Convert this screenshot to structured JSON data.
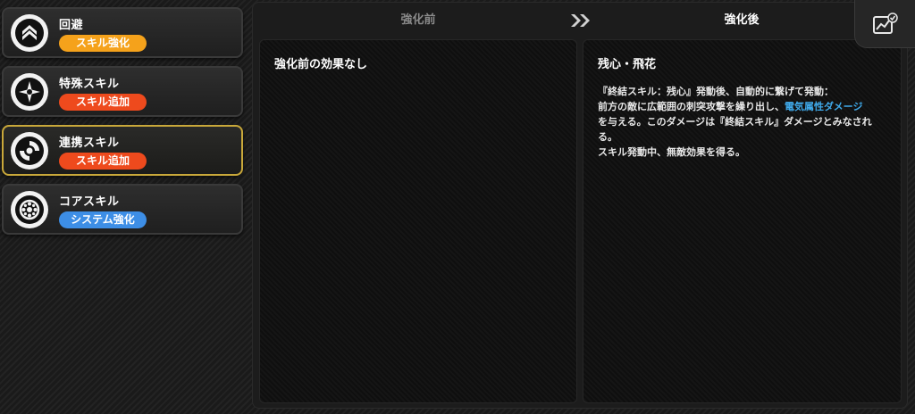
{
  "skills": [
    {
      "name": "回避",
      "tag": "スキル強化",
      "tag_color": "#f5a21b",
      "icon": "evasion-chevron-icon",
      "selected": false
    },
    {
      "name": "特殊スキル",
      "tag": "スキル追加",
      "tag_color": "#ee4a1d",
      "icon": "special-star-icon",
      "selected": false
    },
    {
      "name": "連携スキル",
      "tag": "スキル追加",
      "tag_color": "#ee4a1d",
      "icon": "chain-swirl-icon",
      "selected": true
    },
    {
      "name": "コアスキル",
      "tag": "システム強化",
      "tag_color": "#3d8ee6",
      "icon": "core-wheel-icon",
      "selected": false
    }
  ],
  "compare": {
    "before_label": "強化前",
    "after_label": "強化後",
    "before": {
      "title": "強化前の効果なし"
    },
    "after": {
      "title": "残心・飛花",
      "line1": "『終結スキル：残心』発動後、自動的に繋げて発動：",
      "line2_pre": "前方の敵に広範囲の刺突攻撃を繰り出し、",
      "line2_highlight": "電気属性ダメージ",
      "line3": "を与える。このダメージは『終結スキル』ダメージとみなされる。",
      "line4": "スキル発動中、無敵効果を得る。"
    }
  },
  "colors": {
    "selected_border": "#c9a83a",
    "highlight_text": "#3fa9ea"
  },
  "stats_button_icon": "stats-chart-check-icon"
}
